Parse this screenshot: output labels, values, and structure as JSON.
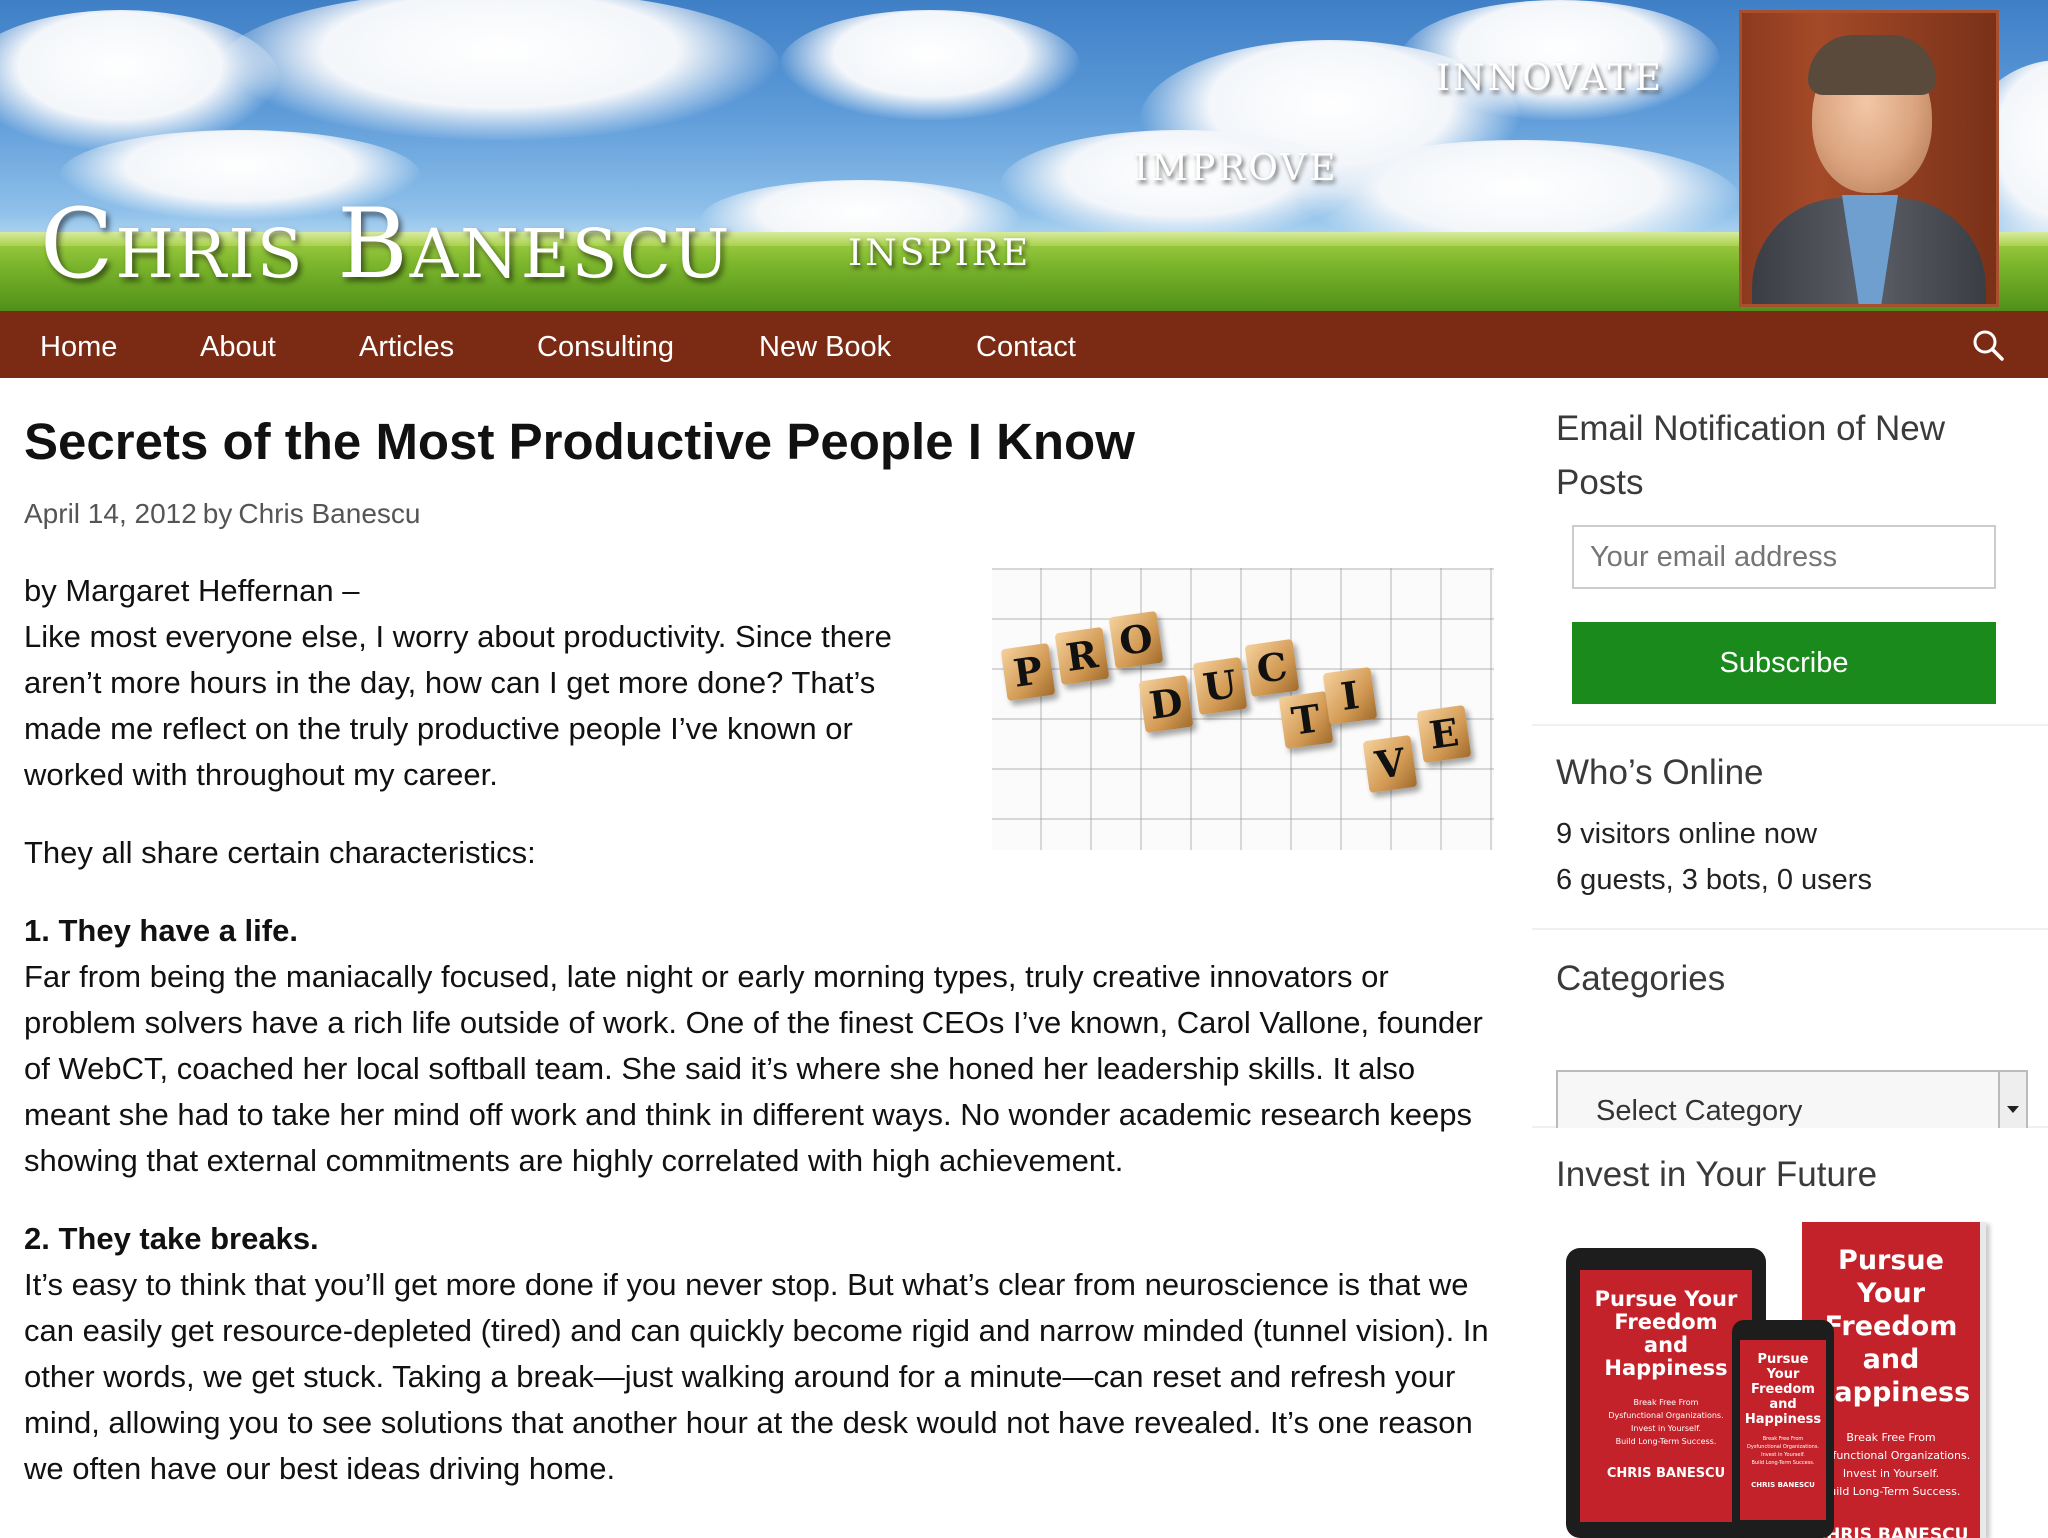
{
  "banner": {
    "site_title": "Chris Banescu",
    "tagwords": [
      "inspire",
      "improve",
      "innovate"
    ]
  },
  "nav": {
    "items": [
      "Home",
      "About",
      "Articles",
      "Consulting",
      "New Book",
      "Contact"
    ],
    "search_icon": "search-icon"
  },
  "post": {
    "title": "Secrets of the Most Productive People I Know",
    "date": "April 14, 2012",
    "by": "by",
    "author": "Chris Banescu",
    "image_letters": [
      "P",
      "R",
      "O",
      "D",
      "U",
      "C",
      "T",
      "I",
      "V",
      "E"
    ],
    "byline": "by Margaret Heffernan –",
    "intro": "Like most everyone else, I worry about productivity. Since there aren’t more hours in the day, how can I get more done? That’s made me reflect on the truly productive people I’ve known or worked with throughout my career.",
    "share": "They all share certain characteristics:",
    "h1": "1. They have a life.",
    "p1": "Far from being the maniacally focused, late night or early morning types, truly creative innovators or problem solvers have a rich life outside of work. One of the finest CEOs I’ve known, Carol Vallone, founder of WebCT, coached her local softball team. She said it’s where she honed her leadership skills. It also meant she had to take her mind off work and think in different ways. No wonder academic research keeps showing that external commitments are highly correlated with high achievement.",
    "h2": "2. They take breaks.",
    "p2": "It’s easy to think that you’ll get more done if you never stop. But what’s clear from neuroscience is that we can easily get resource-depleted (tired) and can quickly become rigid and narrow minded (tunnel vision). In other words, we get stuck. Taking a break—just walking around for a minute—can reset and refresh your mind, allowing you to see solutions that another hour at the desk would not have revealed. It’s one reason we often have our best ideas driving home."
  },
  "sidebar": {
    "email": {
      "title": "Email Notification of New Posts",
      "placeholder": "Your email address",
      "button": "Subscribe"
    },
    "online": {
      "title": "Who’s Online",
      "line1": "9 visitors online now",
      "line2": "6 guests, 3 bots, 0 users"
    },
    "categories": {
      "title": "Categories",
      "selected": "Select Category"
    },
    "invest": {
      "title": "Invest in Your Future",
      "book": {
        "title_lines": [
          "Pursue Your",
          "Freedom",
          "and",
          "Happiness"
        ],
        "subtitle_lines": [
          "Break Free From",
          "Dysfunctional Organizations.",
          "Invest in Yourself.",
          "Build Long-Term Success."
        ],
        "author": "CHRIS BANESCU"
      }
    }
  },
  "colors": {
    "nav_bg": "#7b2a14",
    "subscribe_bg": "#1a8a1d",
    "book_red": "#c4222a"
  }
}
